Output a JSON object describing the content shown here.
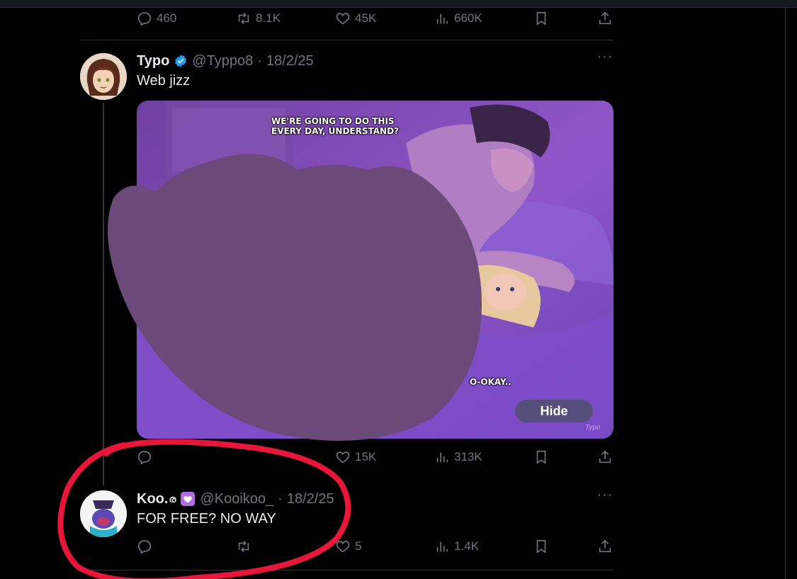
{
  "top_actions": {
    "replies": "460",
    "reposts": "8.1K",
    "likes": "45K",
    "views": "660K"
  },
  "tweet1": {
    "name": "Typo",
    "verified": true,
    "handle": "@Typpo8",
    "dot": "·",
    "date": "18/2/25",
    "text": "Web jizz",
    "more": "···",
    "media": {
      "caption_top": "WE'RE GOING TO DO THIS\nEVERY DAY, UNDERSTAND?",
      "caption_bottom": "O-OKAY..",
      "hide_label": "Hide",
      "watermark": "Typo"
    },
    "actions": {
      "replies": "",
      "reposts": "",
      "likes": "15K",
      "views": "313K"
    }
  },
  "tweet2": {
    "name": "Koo.",
    "name_symbol": "ര",
    "handle": "@Kooikoo_",
    "dot": "·",
    "date": "18/2/25",
    "text": "FOR FREE? NO WAY",
    "more": "···",
    "actions": {
      "replies": "",
      "reposts": "",
      "likes": "5",
      "views": "1.4K"
    }
  },
  "colors": {
    "background": "#000000",
    "text": "#e7e9ea",
    "muted": "#71767b",
    "verified": "#1d9bf0",
    "scribble": "#6b4a7a",
    "circle": "#e8173a"
  },
  "icons": [
    "reply-icon",
    "repost-icon",
    "like-icon",
    "views-icon",
    "bookmark-icon",
    "share-icon",
    "verified-badge-icon",
    "heart-badge-icon",
    "more-icon"
  ]
}
